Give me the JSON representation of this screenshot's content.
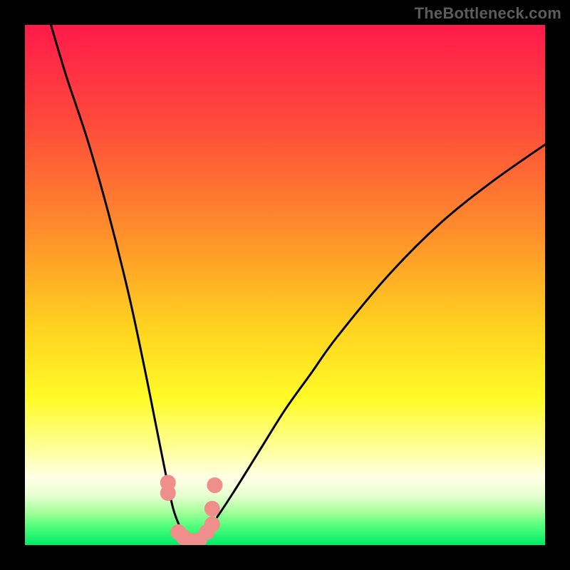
{
  "watermark": "TheBottleneck.com",
  "colors": {
    "frame": "#000000",
    "curve": "#000000",
    "markers": "#ef8e8b",
    "gradient_stops": [
      {
        "offset": 0.0,
        "color": "#ff1a4b"
      },
      {
        "offset": 0.2,
        "color": "#ff4d3a"
      },
      {
        "offset": 0.4,
        "color": "#ff8f2b"
      },
      {
        "offset": 0.58,
        "color": "#ffd21f"
      },
      {
        "offset": 0.72,
        "color": "#fffb28"
      },
      {
        "offset": 0.82,
        "color": "#ffffa0"
      },
      {
        "offset": 0.87,
        "color": "#ffffe6"
      },
      {
        "offset": 0.905,
        "color": "#e6ffd0"
      },
      {
        "offset": 0.935,
        "color": "#a8ff9d"
      },
      {
        "offset": 0.965,
        "color": "#4dff7a"
      },
      {
        "offset": 1.0,
        "color": "#00e968"
      }
    ]
  },
  "chart_data": {
    "type": "line",
    "title": "",
    "xlabel": "",
    "ylabel": "",
    "xlim": [
      0,
      100
    ],
    "ylim": [
      0,
      100
    ],
    "grid": false,
    "note": "Bottleneck-style V-curve. x = relative component balance (arbitrary units), y = bottleneck percentage (0 = no bottleneck, 100 = full bottleneck). Values estimated from plot; no axis tick labels visible.",
    "series": [
      {
        "name": "bottleneck-curve",
        "x": [
          5,
          8,
          12,
          16,
          20,
          23,
          25,
          27,
          28.5,
          30,
          31,
          32,
          33,
          34,
          36,
          40,
          45,
          50,
          55,
          60,
          70,
          80,
          90,
          100
        ],
        "y": [
          100,
          90,
          78,
          64,
          48,
          34,
          24,
          14,
          7,
          3,
          1,
          0,
          0.5,
          1.5,
          4,
          10,
          18,
          26,
          33,
          40,
          52,
          62,
          70,
          77
        ]
      }
    ],
    "markers": {
      "name": "highlight-points",
      "points": [
        {
          "x": 27.5,
          "y": 12
        },
        {
          "x": 27.5,
          "y": 10
        },
        {
          "x": 29.5,
          "y": 2.5
        },
        {
          "x": 30.5,
          "y": 1.5
        },
        {
          "x": 32.0,
          "y": 0.8
        },
        {
          "x": 33.5,
          "y": 1.0
        },
        {
          "x": 35.0,
          "y": 2.5
        },
        {
          "x": 36.0,
          "y": 4.0
        },
        {
          "x": 36.5,
          "y": 11.5
        },
        {
          "x": 36.0,
          "y": 7.0
        }
      ]
    }
  }
}
